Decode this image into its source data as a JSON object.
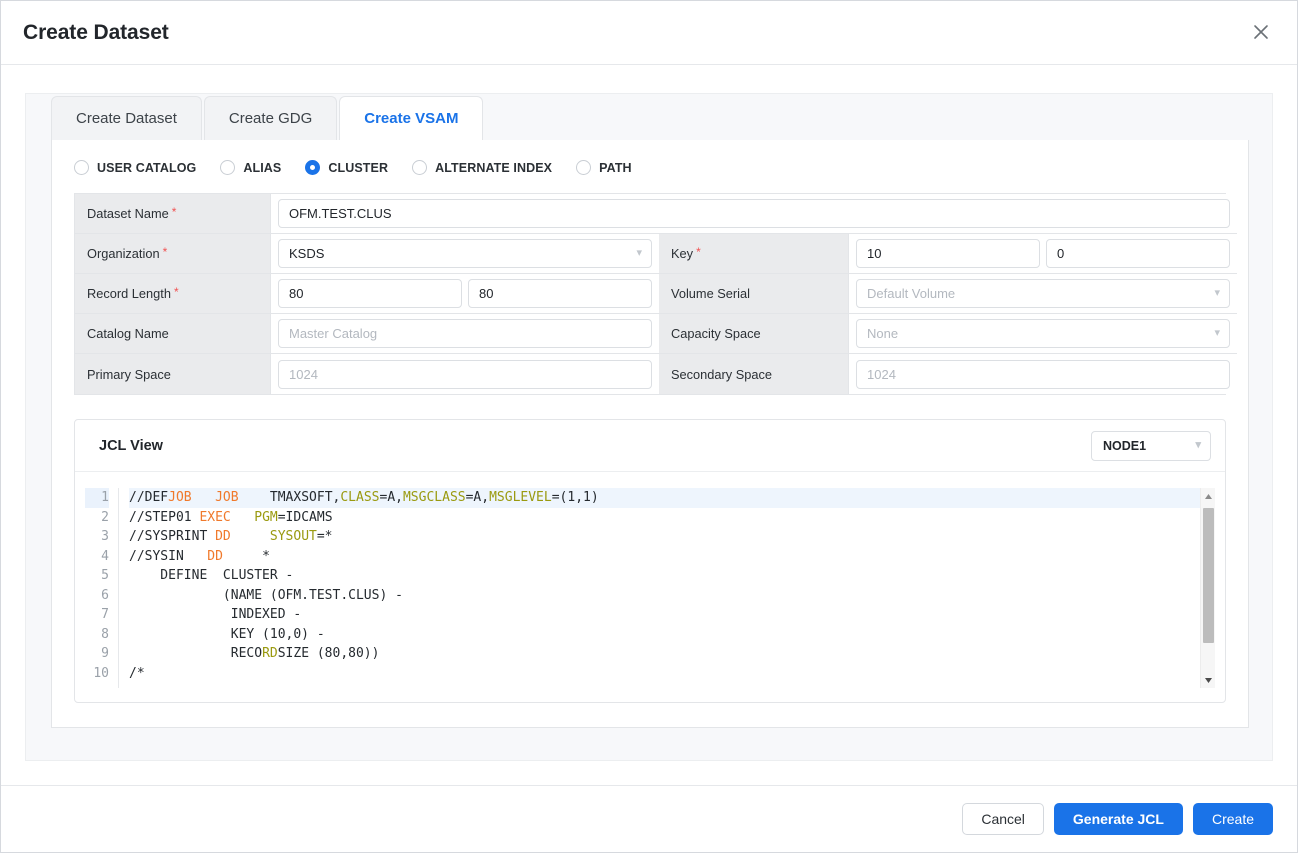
{
  "dialog": {
    "title": "Create Dataset",
    "close_icon": "close-icon"
  },
  "tabs": [
    {
      "label": "Create Dataset",
      "active": false
    },
    {
      "label": "Create GDG",
      "active": false
    },
    {
      "label": "Create VSAM",
      "active": true
    }
  ],
  "radios": [
    {
      "label": "USER CATALOG",
      "checked": false
    },
    {
      "label": "ALIAS",
      "checked": false
    },
    {
      "label": "CLUSTER",
      "checked": true
    },
    {
      "label": "ALTERNATE INDEX",
      "checked": false
    },
    {
      "label": "PATH",
      "checked": false
    }
  ],
  "form": {
    "dataset_name": {
      "label": "Dataset Name",
      "required": true,
      "value": "OFM.TEST.CLUS"
    },
    "organization": {
      "label": "Organization",
      "required": true,
      "value": "KSDS"
    },
    "key": {
      "label": "Key",
      "required": true,
      "value1": "10",
      "value2": "0"
    },
    "record_length": {
      "label": "Record Length",
      "required": true,
      "value1": "80",
      "value2": "80"
    },
    "volume_serial": {
      "label": "Volume Serial",
      "required": false,
      "placeholder": "Default Volume"
    },
    "catalog_name": {
      "label": "Catalog Name",
      "required": false,
      "placeholder": "Master Catalog"
    },
    "capacity_space": {
      "label": "Capacity Space",
      "required": false,
      "placeholder": "None"
    },
    "primary_space": {
      "label": "Primary Space",
      "required": false,
      "placeholder": "1024"
    },
    "secondary_space": {
      "label": "Secondary Space",
      "required": false,
      "placeholder": "1024"
    }
  },
  "jcl": {
    "title": "JCL View",
    "node_selected": "NODE1",
    "line_numbers": [
      "1",
      "2",
      "3",
      "4",
      "5",
      "6",
      "7",
      "8",
      "9",
      "10"
    ],
    "active_line": 1,
    "lines": [
      [
        {
          "t": "//DEF",
          "c": "plain"
        },
        {
          "t": "JOB",
          "c": "orange"
        },
        {
          "t": "   ",
          "c": "plain"
        },
        {
          "t": "JOB",
          "c": "orange"
        },
        {
          "t": "    ",
          "c": "plain"
        },
        {
          "t": "TMAXSOFT,",
          "c": "plain"
        },
        {
          "t": "CLASS",
          "c": "olive"
        },
        {
          "t": "=A,",
          "c": "plain"
        },
        {
          "t": "MSGCLASS",
          "c": "olive"
        },
        {
          "t": "=A,",
          "c": "plain"
        },
        {
          "t": "MSGLEVEL",
          "c": "olive"
        },
        {
          "t": "=(1,1)",
          "c": "plain"
        }
      ],
      [
        {
          "t": "//STEP01 ",
          "c": "plain"
        },
        {
          "t": "EXEC",
          "c": "orange"
        },
        {
          "t": "   ",
          "c": "plain"
        },
        {
          "t": "PGM",
          "c": "olive"
        },
        {
          "t": "=IDCAMS",
          "c": "plain"
        }
      ],
      [
        {
          "t": "//SYSPRINT ",
          "c": "plain"
        },
        {
          "t": "DD",
          "c": "orange"
        },
        {
          "t": "     ",
          "c": "plain"
        },
        {
          "t": "SYSOUT",
          "c": "olive"
        },
        {
          "t": "=*",
          "c": "plain"
        }
      ],
      [
        {
          "t": "//SYSIN   ",
          "c": "plain"
        },
        {
          "t": "DD",
          "c": "orange"
        },
        {
          "t": "     ",
          "c": "plain"
        },
        {
          "t": "*",
          "c": "plain"
        }
      ],
      [
        {
          "t": "    DEFINE  CLUSTER -",
          "c": "plain"
        }
      ],
      [
        {
          "t": "            (NAME (OFM.TEST.CLUS) -",
          "c": "plain"
        }
      ],
      [
        {
          "t": "             INDEXED -",
          "c": "plain"
        }
      ],
      [
        {
          "t": "             KEY (10,0) -",
          "c": "plain"
        }
      ],
      [
        {
          "t": "             RECO",
          "c": "plain"
        },
        {
          "t": "RD",
          "c": "olive"
        },
        {
          "t": "SIZE (80,80))",
          "c": "plain"
        }
      ],
      [
        {
          "t": "/*",
          "c": "plain"
        }
      ]
    ]
  },
  "footer": {
    "cancel_label": "Cancel",
    "generate_label": "Generate JCL",
    "create_label": "Create"
  },
  "colors": {
    "accent": "#1a73e8",
    "required": "#f05252",
    "keyword_orange": "#f0792b",
    "keyword_olive": "#9a9a10",
    "label_bg": "#eaebed",
    "panel_bg": "#f7f8fa"
  }
}
